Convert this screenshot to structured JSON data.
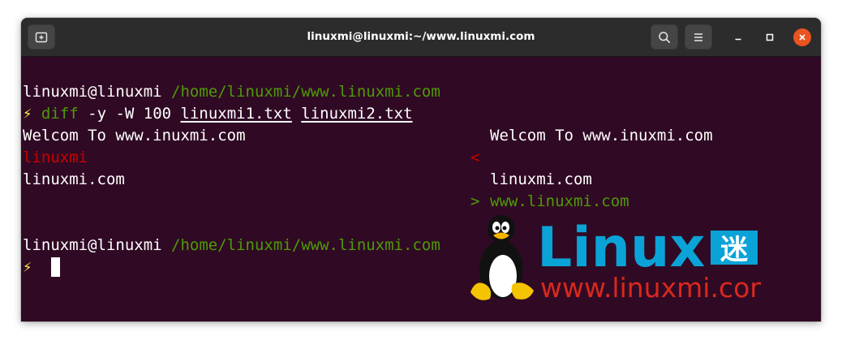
{
  "window": {
    "title": "linuxmi@linuxmi:~/www.linuxmi.com"
  },
  "icons": {
    "new_tab": "new-tab-icon",
    "search": "search-icon",
    "menu": "hamburger-menu-icon",
    "minimize": "minimize-icon",
    "maximize": "maximize-icon",
    "close": "close-icon"
  },
  "terminal": {
    "prompt1": {
      "user_host": "linuxmi@linuxmi",
      "path": "/home/linuxmi/www.linuxmi.com"
    },
    "command": {
      "symbol": "⚡",
      "cmd": "diff",
      "args": "-y -W 100",
      "file1": "linuxmi1.txt",
      "file2": "linuxmi2.txt"
    },
    "output": {
      "row1_left": "Welcom To www.inuxmi.com",
      "row1_right": "Welcom To www.inuxmi.com",
      "row2_left": "linuxmi",
      "row2_marker": "<",
      "row3_left": "linuxmi.com",
      "row3_right": "linuxmi.com",
      "row4_marker": ">",
      "row4_right": "www.linuxmi.com"
    },
    "prompt2": {
      "user_host": "linuxmi@linuxmi",
      "path": "/home/linuxmi/www.linuxmi.com",
      "symbol": "⚡"
    }
  },
  "watermark": {
    "brand": "Linux",
    "brand_cn": "迷",
    "url": "www.linuxmi.com"
  },
  "colors": {
    "terminal_bg": "#300a24",
    "titlebar_bg": "#2c2c2c",
    "path_green": "#4e9a06",
    "removed_red": "#cc0000",
    "close_orange": "#e95420",
    "logo_blue": "#0aa3d8",
    "logo_red": "#d9281d"
  }
}
